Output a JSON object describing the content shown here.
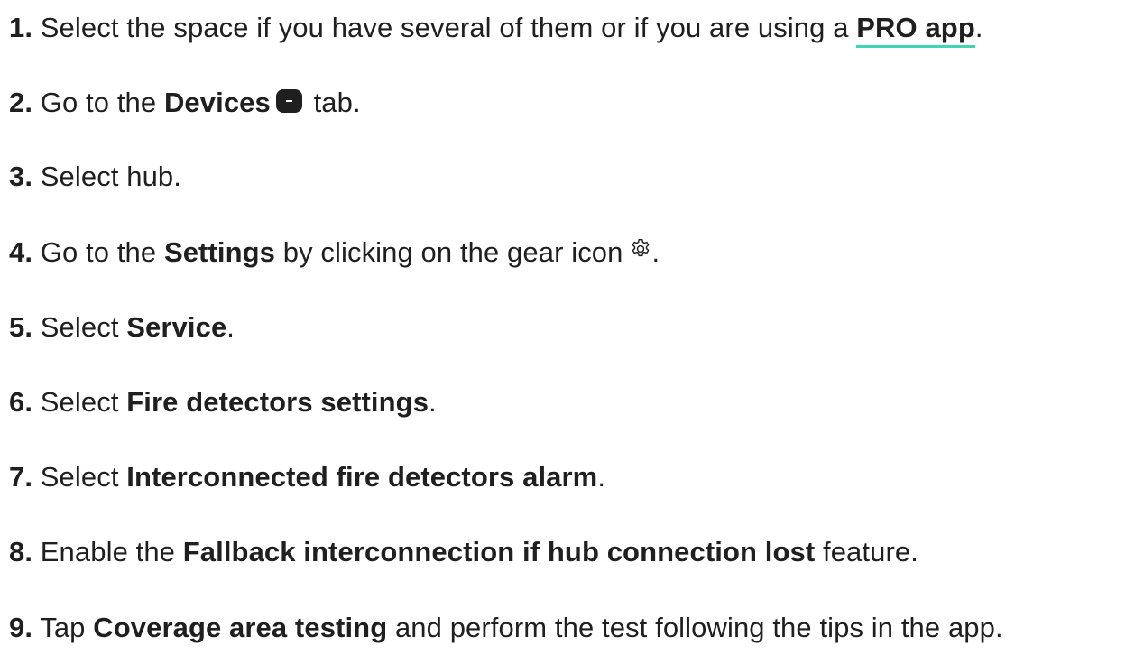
{
  "steps": [
    {
      "num": "1.",
      "pre": "Select the space if you have several of them or if you are using a",
      "link": "PRO app",
      "post": "."
    },
    {
      "num": "2.",
      "pre": "Go to the",
      "bold": "Devices",
      "icon": "devices-tab-icon",
      "post": "tab."
    },
    {
      "num": "3.",
      "pre": "Select hub."
    },
    {
      "num": "4.",
      "pre": "Go to the",
      "bold": "Settings",
      "mid": "by clicking on the gear icon",
      "icon": "gear-icon",
      "post": "."
    },
    {
      "num": "5.",
      "pre": "Select",
      "bold": "Service",
      "post": "."
    },
    {
      "num": "6.",
      "pre": "Select",
      "bold": "Fire detectors settings",
      "post": "."
    },
    {
      "num": "7.",
      "pre": "Select",
      "bold": "Interconnected fire detectors alarm",
      "post": "."
    },
    {
      "num": "8.",
      "pre": "Enable the",
      "bold": "Fallback interconnection if hub connection lost",
      "post": "feature."
    },
    {
      "num": "9.",
      "pre": "Tap",
      "bold": "Coverage area testing",
      "post": "and perform the test following the tips in the app."
    }
  ],
  "colors": {
    "text": "#1f1f1f",
    "link_underline": "#3fd6b0",
    "background": "#ffffff"
  }
}
